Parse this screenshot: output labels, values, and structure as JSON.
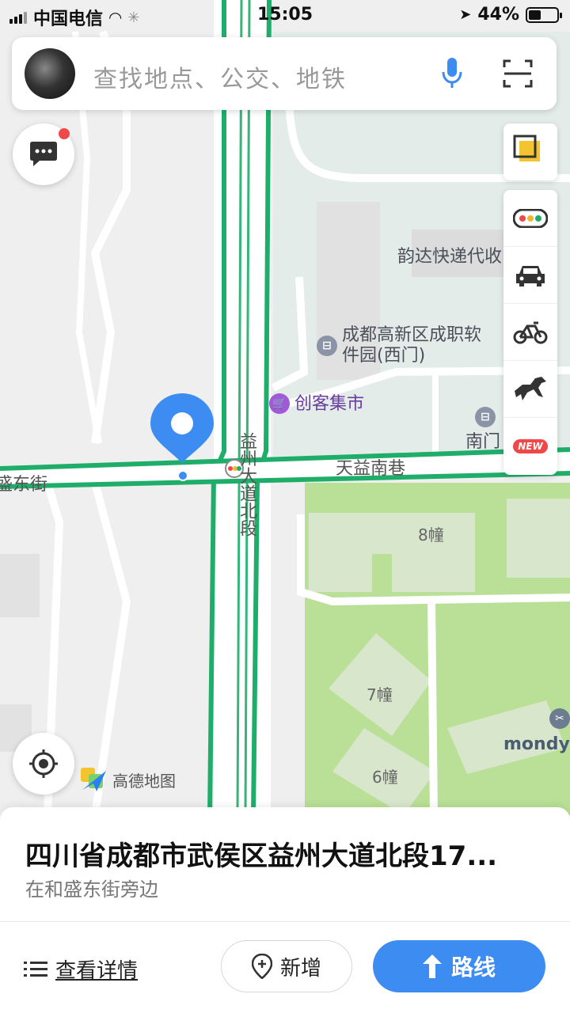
{
  "status_bar": {
    "carrier": "中国电信",
    "time": "15:05",
    "battery_text": "44%",
    "battery_level": 0.44
  },
  "search": {
    "placeholder": "查找地点、公交、地铁"
  },
  "map": {
    "roads": [
      {
        "name": "天益南巷"
      },
      {
        "name": "盛东街"
      },
      {
        "name": "益州大道北段"
      }
    ],
    "pois": [
      {
        "name": "韵达快递代收"
      },
      {
        "name": "成都高新区成职软件园(西门)"
      },
      {
        "name": "创客集市"
      },
      {
        "name": "南门"
      },
      {
        "name": "mondy"
      }
    ],
    "buildings": [
      {
        "name": "8幢"
      },
      {
        "name": "7幢"
      },
      {
        "name": "6幢"
      }
    ],
    "brand": "高德地图"
  },
  "tools": {
    "new_badge": "NEW"
  },
  "location_card": {
    "address": "四川省成都市武侯区益州大道北段17...",
    "sub": "在和盛东街旁边",
    "details_label": "查看详情",
    "add_label": "新增",
    "route_label": "路线"
  },
  "colors": {
    "accent": "#3d8cf2",
    "road_border": "#1fae6a",
    "green_area": "#b5e08c",
    "badge_red": "#f04848"
  }
}
